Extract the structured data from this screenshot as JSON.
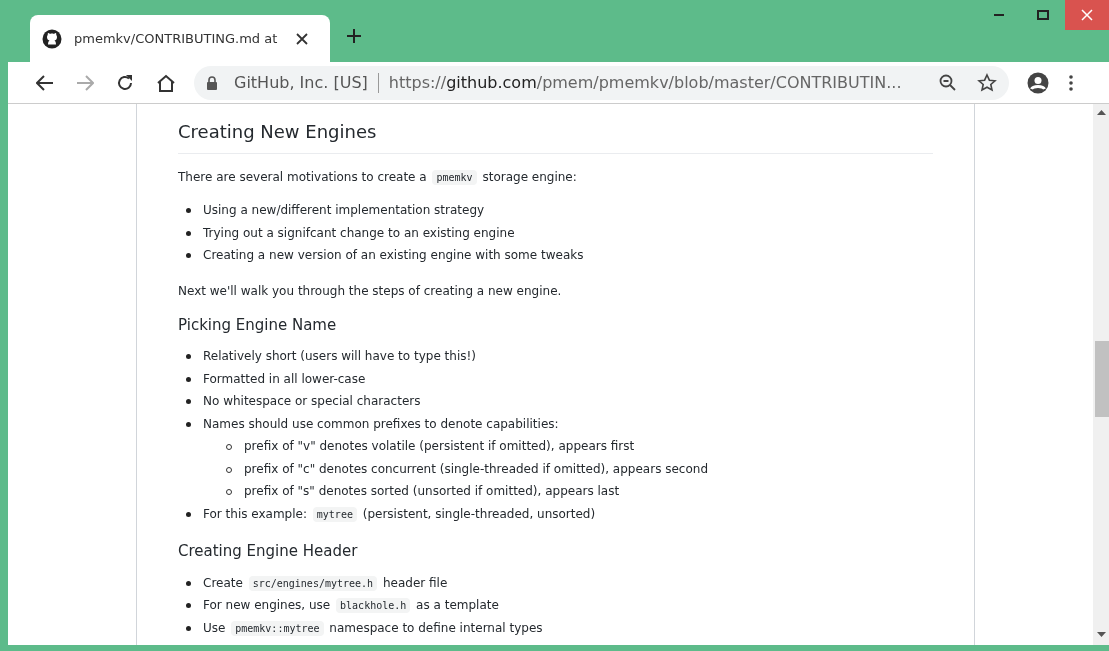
{
  "tab": {
    "title": "pmemkv/CONTRIBUTING.md at",
    "selected": true
  },
  "address_bar": {
    "security_label": "GitHub, Inc. [US]",
    "url_scheme": "https://",
    "url_host": "github.com",
    "url_path": "/pmem/pmemkv/blob/master/CONTRIBUTIN..."
  },
  "article": [
    {
      "kind": "h2",
      "text": "Creating New Engines"
    },
    {
      "kind": "p",
      "parts": [
        {
          "kind": "text",
          "text": "There are several motivations to create a "
        },
        {
          "kind": "code",
          "text": "pmemkv"
        },
        {
          "kind": "text",
          "text": " storage engine:"
        }
      ]
    },
    {
      "kind": "ul",
      "items": [
        {
          "parts": [
            {
              "kind": "text",
              "text": "Using a new/different implementation strategy"
            }
          ]
        },
        {
          "parts": [
            {
              "kind": "text",
              "text": "Trying out a signifcant change to an existing engine"
            }
          ]
        },
        {
          "parts": [
            {
              "kind": "text",
              "text": "Creating a new version of an existing engine with some tweaks"
            }
          ]
        }
      ]
    },
    {
      "kind": "p",
      "parts": [
        {
          "kind": "text",
          "text": "Next we'll walk you through the steps of creating a new engine."
        }
      ]
    },
    {
      "kind": "h3",
      "text": "Picking Engine Name"
    },
    {
      "kind": "ul",
      "items": [
        {
          "parts": [
            {
              "kind": "text",
              "text": "Relatively short (users will have to type this!)"
            }
          ]
        },
        {
          "parts": [
            {
              "kind": "text",
              "text": "Formatted in all lower-case"
            }
          ]
        },
        {
          "parts": [
            {
              "kind": "text",
              "text": "No whitespace or special characters"
            }
          ]
        },
        {
          "parts": [
            {
              "kind": "text",
              "text": "Names should use common prefixes to denote capabilities:"
            }
          ],
          "children": [
            {
              "parts": [
                {
                  "kind": "text",
                  "text": "prefix of \"v\" denotes volatile (persistent if omitted), appears first"
                }
              ]
            },
            {
              "parts": [
                {
                  "kind": "text",
                  "text": "prefix of \"c\" denotes concurrent (single-threaded if omitted), appears second"
                }
              ]
            },
            {
              "parts": [
                {
                  "kind": "text",
                  "text": "prefix of \"s\" denotes sorted (unsorted if omitted), appears last"
                }
              ]
            }
          ]
        },
        {
          "parts": [
            {
              "kind": "text",
              "text": "For this example: "
            },
            {
              "kind": "code",
              "text": "mytree"
            },
            {
              "kind": "text",
              "text": " (persistent, single-threaded, unsorted)"
            }
          ]
        }
      ]
    },
    {
      "kind": "h3",
      "text": "Creating Engine Header"
    },
    {
      "kind": "ul",
      "items": [
        {
          "parts": [
            {
              "kind": "text",
              "text": "Create "
            },
            {
              "kind": "code",
              "text": "src/engines/mytree.h"
            },
            {
              "kind": "text",
              "text": " header file"
            }
          ]
        },
        {
          "parts": [
            {
              "kind": "text",
              "text": "For new engines, use "
            },
            {
              "kind": "code",
              "text": "blackhole.h"
            },
            {
              "kind": "text",
              "text": " as a template"
            }
          ]
        },
        {
          "parts": [
            {
              "kind": "text",
              "text": "Use "
            },
            {
              "kind": "code",
              "text": "pmemkv::mytree"
            },
            {
              "kind": "text",
              "text": " namespace to define internal types"
            }
          ]
        }
      ]
    }
  ]
}
